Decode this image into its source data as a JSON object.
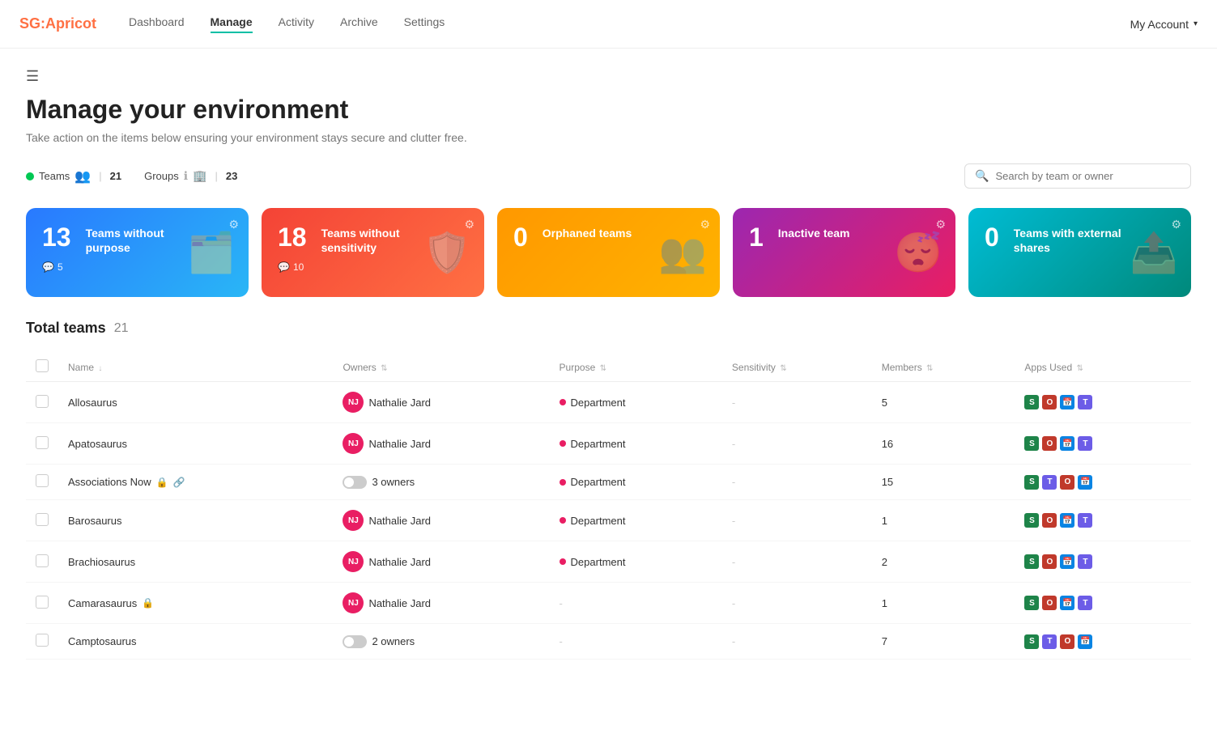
{
  "nav": {
    "logo_sg": "SG:",
    "logo_app": "Apricot",
    "links": [
      {
        "label": "Dashboard",
        "active": false
      },
      {
        "label": "Manage",
        "active": true
      },
      {
        "label": "Activity",
        "active": false
      },
      {
        "label": "Archive",
        "active": false
      },
      {
        "label": "Settings",
        "active": false
      }
    ],
    "account_label": "My Account"
  },
  "page": {
    "title": "Manage your environment",
    "subtitle": "Take action on the items below ensuring your environment stays secure and clutter free."
  },
  "filters": {
    "teams_label": "Teams",
    "teams_count": "21",
    "groups_label": "Groups",
    "groups_count": "23",
    "search_placeholder": "Search by team or owner"
  },
  "cards": [
    {
      "num": "13",
      "label": "Teams without purpose",
      "sub_count": "5",
      "sub_icon": "💬",
      "art": "🗂️",
      "style": "card-blue"
    },
    {
      "num": "18",
      "label": "Teams without sensitivity",
      "sub_count": "10",
      "sub_icon": "💬",
      "art": "🛡️",
      "style": "card-red"
    },
    {
      "num": "0",
      "label": "Orphaned teams",
      "sub_count": "",
      "sub_icon": "",
      "art": "👥",
      "style": "card-orange"
    },
    {
      "num": "1",
      "label": "Inactive team",
      "sub_count": "",
      "sub_icon": "",
      "art": "😴",
      "style": "card-purple"
    },
    {
      "num": "0",
      "label": "Teams with external shares",
      "sub_count": "",
      "sub_icon": "",
      "art": "📤",
      "style": "card-teal"
    }
  ],
  "table": {
    "section_label": "Total teams",
    "total_count": "21",
    "columns": [
      "Name",
      "Owners",
      "Purpose",
      "Sensitivity",
      "Members",
      "Apps Used"
    ],
    "rows": [
      {
        "name": "Allosaurus",
        "lock": false,
        "owner_type": "avatar",
        "owner_initials": "NJ",
        "owner_name": "Nathalie Jard",
        "purpose": "Department",
        "sensitivity": "-",
        "members": "5",
        "apps": [
          "S",
          "O",
          "📅",
          "T"
        ]
      },
      {
        "name": "Apatosaurus",
        "lock": false,
        "owner_type": "avatar",
        "owner_initials": "NJ",
        "owner_name": "Nathalie Jard",
        "purpose": "Department",
        "sensitivity": "-",
        "members": "16",
        "apps": [
          "S",
          "O",
          "📅",
          "T"
        ]
      },
      {
        "name": "Associations Now",
        "lock": true,
        "extra_icon": true,
        "owner_type": "toggle",
        "owner_name": "3 owners",
        "purpose": "Department",
        "sensitivity": "-",
        "members": "15",
        "apps": [
          "S",
          "T",
          "O",
          "📅"
        ]
      },
      {
        "name": "Barosaurus",
        "lock": false,
        "owner_type": "avatar",
        "owner_initials": "NJ",
        "owner_name": "Nathalie Jard",
        "purpose": "Department",
        "sensitivity": "-",
        "members": "1",
        "apps": [
          "S",
          "O",
          "📅",
          "T"
        ]
      },
      {
        "name": "Brachiosaurus",
        "lock": false,
        "owner_type": "avatar",
        "owner_initials": "NJ",
        "owner_name": "Nathalie Jard",
        "purpose": "Department",
        "sensitivity": "-",
        "members": "2",
        "apps": [
          "S",
          "O",
          "📅",
          "T"
        ]
      },
      {
        "name": "Camarasaurus",
        "lock": true,
        "owner_type": "avatar",
        "owner_initials": "NJ",
        "owner_name": "Nathalie Jard",
        "purpose": "-",
        "sensitivity": "-",
        "members": "1",
        "apps": [
          "S",
          "O",
          "📅",
          "T"
        ]
      },
      {
        "name": "Camptosaurus",
        "lock": false,
        "owner_type": "toggle",
        "owner_name": "2 owners",
        "purpose": "-",
        "sensitivity": "-",
        "members": "7",
        "apps": [
          "S",
          "T",
          "O",
          "📅"
        ]
      }
    ]
  }
}
